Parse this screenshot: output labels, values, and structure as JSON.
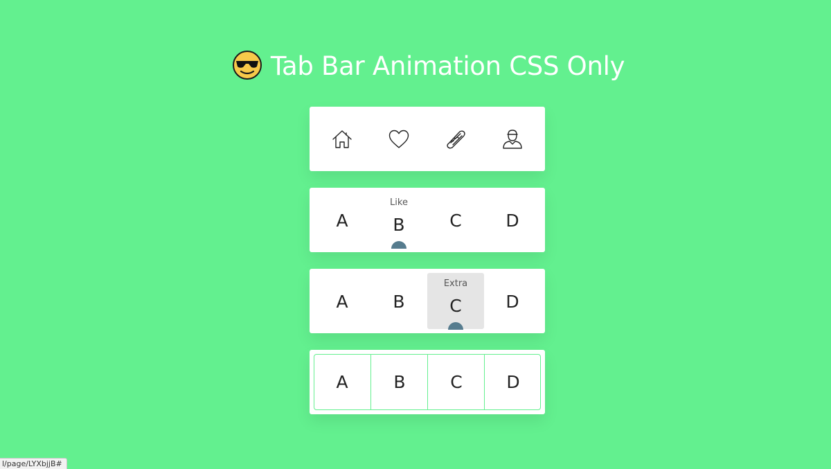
{
  "header": {
    "title": "Tab Bar Animation CSS Only",
    "emoji_icon": "smiling-face-with-sunglasses-icon"
  },
  "bar_1": {
    "tabs": [
      {
        "icon": "home-icon"
      },
      {
        "icon": "heart-icon"
      },
      {
        "icon": "hotdog-icon"
      },
      {
        "icon": "user-icon"
      }
    ]
  },
  "bar_2": {
    "tabs": [
      {
        "label": "A"
      },
      {
        "label": "B",
        "hint": "Like"
      },
      {
        "label": "C"
      },
      {
        "label": "D"
      }
    ],
    "active_index": 1,
    "indicator_color": "#567c8e"
  },
  "bar_3": {
    "tabs": [
      {
        "label": "A"
      },
      {
        "label": "B"
      },
      {
        "label": "C",
        "hint": "Extra"
      },
      {
        "label": "D"
      }
    ],
    "active_index": 2,
    "highlight_color": "#e5e5e5",
    "indicator_color": "#567c8e"
  },
  "bar_4": {
    "tabs": [
      {
        "label": "A"
      },
      {
        "label": "B"
      },
      {
        "label": "C"
      },
      {
        "label": "D"
      }
    ],
    "border_color": "#63f08f"
  },
  "status_bar": {
    "url": "l/page/LYXbjjB#"
  },
  "theme": {
    "background": "#63f08f",
    "card": "#ffffff"
  }
}
